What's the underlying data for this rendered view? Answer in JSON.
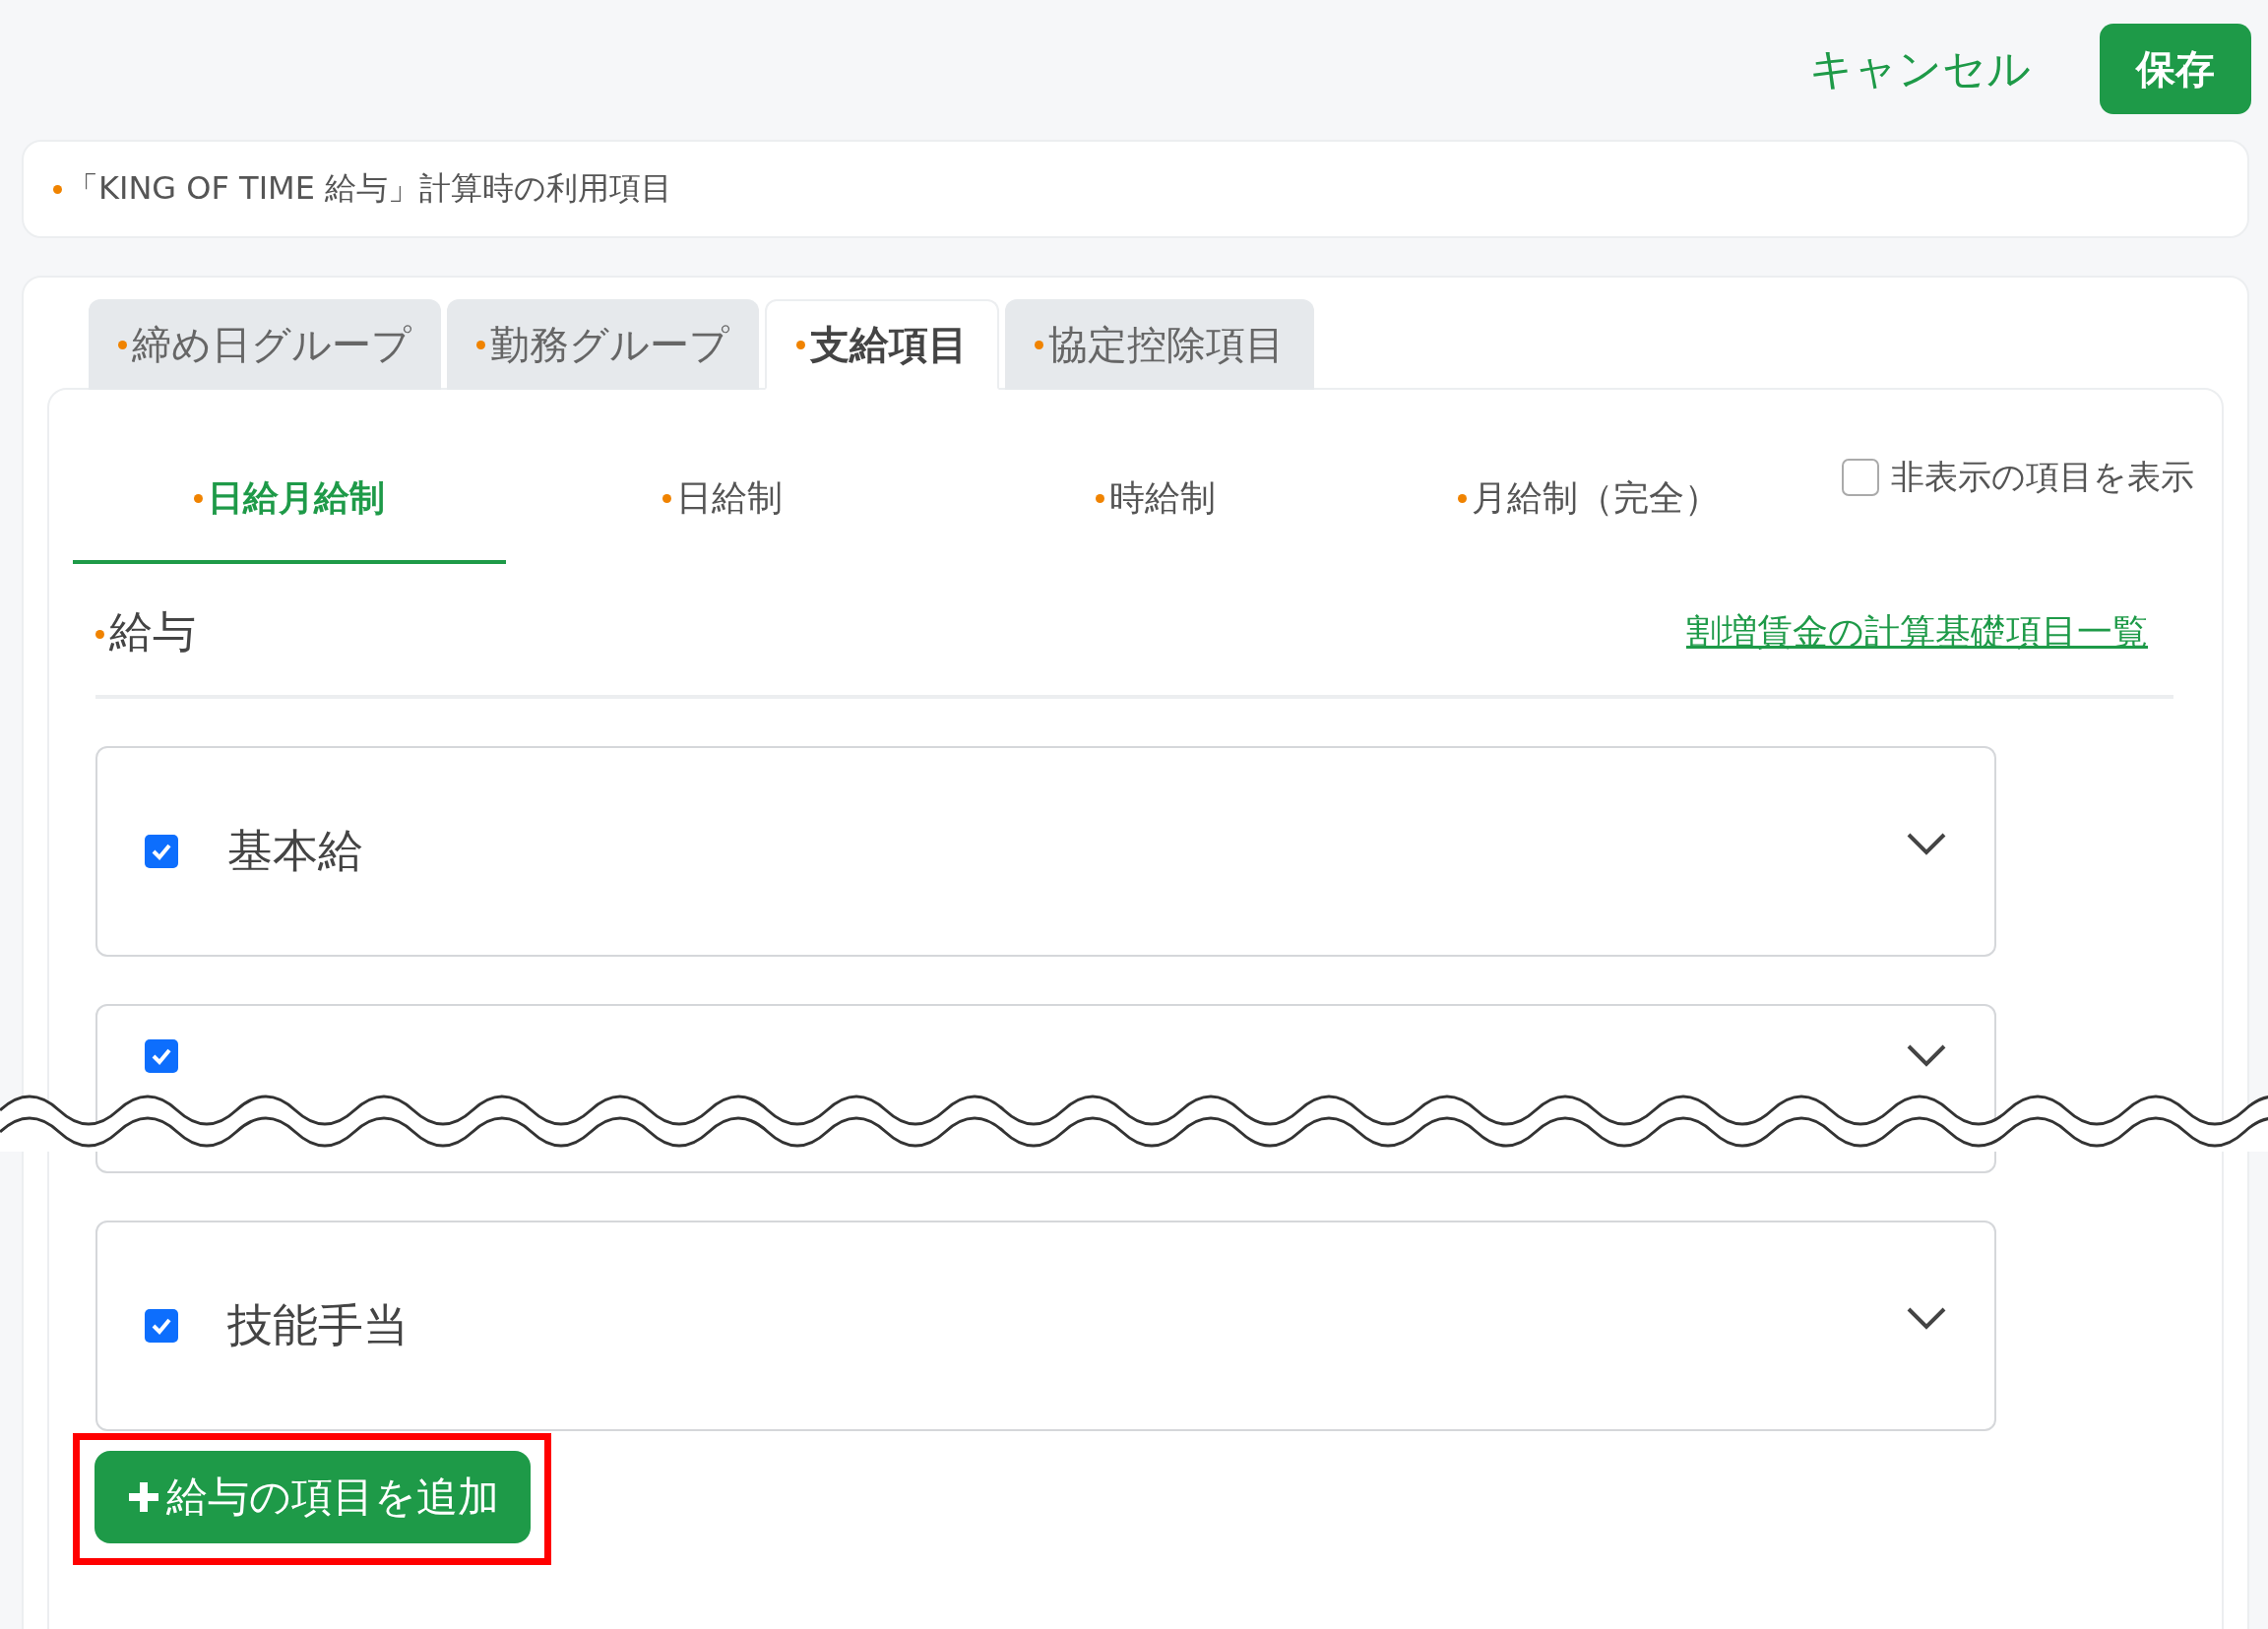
{
  "header": {
    "cancel": "キャンセル",
    "save": "保存"
  },
  "notice": "「KING OF TIME 給与」計算時の利用項目",
  "tabs": [
    {
      "label": "締め日グループ",
      "selected": false
    },
    {
      "label": "勤務グループ",
      "selected": false
    },
    {
      "label": "支給項目",
      "selected": true
    },
    {
      "label": "協定控除項目",
      "selected": false
    }
  ],
  "sub_tabs": [
    {
      "label": "日給月給制",
      "selected": true
    },
    {
      "label": "日給制",
      "selected": false
    },
    {
      "label": "時給制",
      "selected": false
    },
    {
      "label": "月給制（完全）",
      "selected": false
    }
  ],
  "show_hidden": {
    "label": "非表示の項目を表示",
    "checked": false
  },
  "section": {
    "title": "給与",
    "link": "割増賃金の計算基礎項目一覧"
  },
  "items": [
    {
      "label": "基本給",
      "checked": true,
      "cut": false
    },
    {
      "checked": true,
      "cut": true
    },
    {
      "label": "技能手当",
      "checked": true,
      "cut": false
    }
  ],
  "add_button": {
    "label": "給与の項目を追加",
    "highlighted": true
  }
}
